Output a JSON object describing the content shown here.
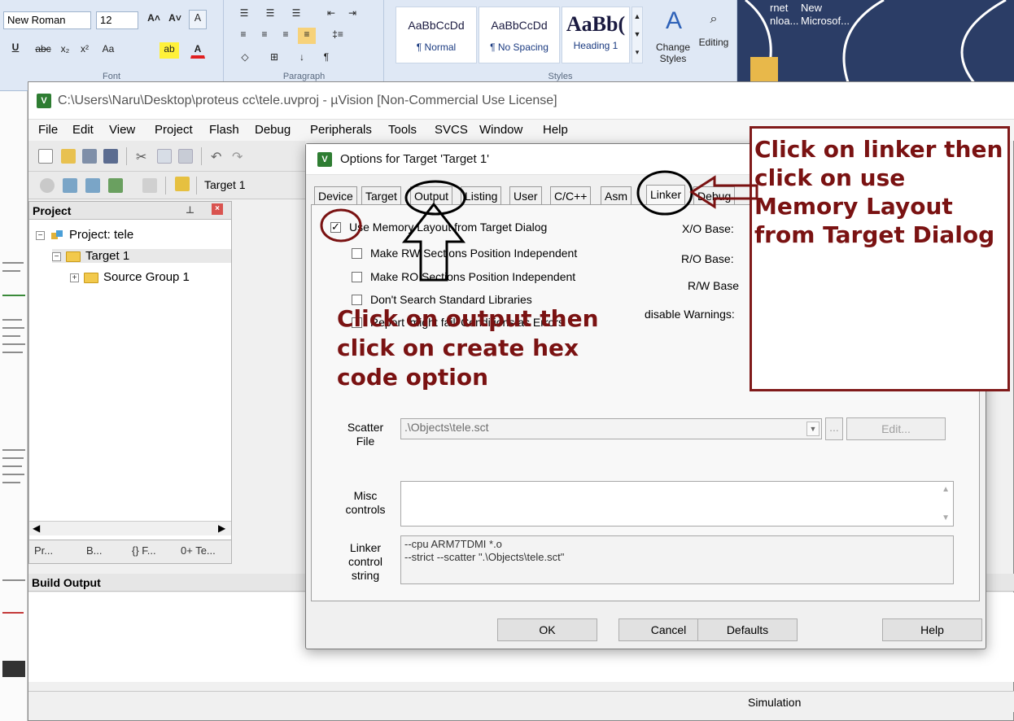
{
  "ribbon": {
    "font_name": "New Roman",
    "font_size": "12",
    "group_font": "Font",
    "group_paragraph": "Paragraph",
    "group_styles": "Styles",
    "styles": [
      {
        "sample": "AaBbCcDd",
        "name": "¶ Normal"
      },
      {
        "sample": "AaBbCcDd",
        "name": "¶ No Spacing"
      },
      {
        "sample": "AaBb(",
        "name": "Heading 1"
      }
    ],
    "change_styles": "Change Styles",
    "editing": "Editing"
  },
  "desktop": {
    "item1": "rnet\nnloa...",
    "item2": "New\nMicrosof..."
  },
  "uvision": {
    "title": "C:\\Users\\Naru\\Desktop\\proteus cc\\tele.uvproj - µVision  [Non-Commercial Use License]",
    "menu": [
      "File",
      "Edit",
      "View",
      "Project",
      "Flash",
      "Debug",
      "Peripherals",
      "Tools",
      "SVCS",
      "Window",
      "Help"
    ],
    "target_select": "Target 1",
    "project_pane_title": "Project",
    "tree": {
      "project": "Project: tele",
      "target": "Target 1",
      "group": "Source Group 1"
    },
    "pane_tabs": [
      "Pr...",
      "B...",
      "{} F...",
      "0+ Te..."
    ],
    "build_output_title": "Build Output",
    "status_simulation": "Simulation"
  },
  "dialog": {
    "title": "Options for Target 'Target 1'",
    "tabs": [
      "Device",
      "Target",
      "Output",
      "Listing",
      "User",
      "C/C++",
      "Asm",
      "Linker",
      "Debug"
    ],
    "active_tab": "Linker",
    "checkboxes": [
      {
        "label": "Use Memory Layout from Target Dialog",
        "checked": true
      },
      {
        "label": "Make RW Sections Position Independent",
        "checked": false
      },
      {
        "label": "Make RO Sections Position Independent",
        "checked": false
      },
      {
        "label": "Don't Search Standard Libraries",
        "checked": false
      },
      {
        "label": "Report 'might fail' Conditions as Errors",
        "checked": false
      }
    ],
    "right_labels": [
      "X/O Base:",
      "R/O Base:",
      "R/W Base",
      "disable Warnings:"
    ],
    "scatter_label": "Scatter\nFile",
    "scatter_value": ".\\Objects\\tele.sct",
    "browse_label": "...",
    "edit_label": "Edit...",
    "misc_label": "Misc\ncontrols",
    "misc_value": "",
    "linker_label": "Linker\ncontrol\nstring",
    "linker_value": "--cpu ARM7TDMI *.o\n--strict --scatter \".\\Objects\\tele.sct\"",
    "buttons": {
      "ok": "OK",
      "cancel": "Cancel",
      "defaults": "Defaults",
      "help": "Help"
    }
  },
  "annotations": {
    "linker_note": "Click on linker then click on use Memory Layout from Target Dialog",
    "output_note": "Click on output then click on create hex code option",
    "color": "#7a1212"
  }
}
